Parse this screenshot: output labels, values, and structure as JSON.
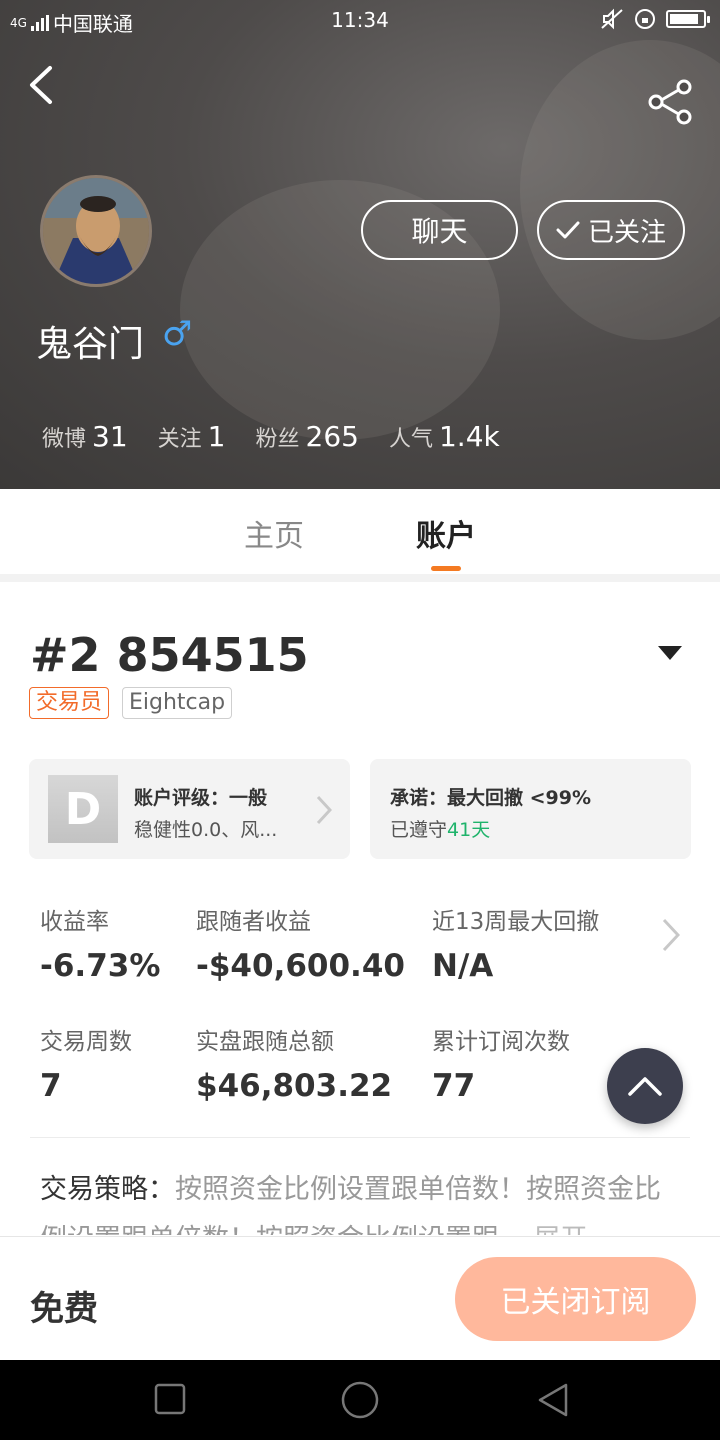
{
  "status_bar": {
    "network": "4G",
    "carrier": "中国联通",
    "time": "11:34",
    "battery_level": 0.9
  },
  "profile": {
    "username": "鬼谷门",
    "gender_symbol": "♂",
    "chat_label": "聊天",
    "follow_label": "已关注",
    "stats": [
      {
        "label": "微博",
        "value": "31"
      },
      {
        "label": "关注",
        "value": "1"
      },
      {
        "label": "粉丝",
        "value": "265"
      },
      {
        "label": "人气",
        "value": "1.4k"
      }
    ]
  },
  "tabs": [
    {
      "label": "主页",
      "active": false
    },
    {
      "label": "账户",
      "active": true
    }
  ],
  "account": {
    "title": "#2 854515",
    "tags": [
      "交易员",
      "Eightcap"
    ],
    "rating_card": {
      "grade": "D",
      "line1": "账户评级：一般",
      "line2": "稳健性0.0、风..."
    },
    "promise_card": {
      "line1": "承诺：最大回撤 <99%",
      "line2_prefix": "已遵守",
      "line2_days": "41天"
    },
    "metrics": [
      {
        "label": "收益率",
        "value": "-6.73%"
      },
      {
        "label": "跟随者收益",
        "value": "-$40,600.40"
      },
      {
        "label": "近13周最大回撤",
        "value": "N/A"
      },
      {
        "label": "交易周数",
        "value": "7"
      },
      {
        "label": "实盘跟随总额",
        "value": "$46,803.22"
      },
      {
        "label": "累计订阅次数",
        "value": "77"
      }
    ],
    "strategy": {
      "label": "交易策略：",
      "text": "按照资金比例设置跟单倍数！按照资金比例设置跟单倍数！按照资金比例设置跟...",
      "expand": "展开"
    }
  },
  "bottom_bar": {
    "price": "免费",
    "subscribe_label": "已关闭订阅"
  },
  "colors": {
    "accent": "#f47a22",
    "tag_orange": "#f26b2a",
    "green": "#1fb36b",
    "subscribe_bg": "#ffb89c",
    "fab_bg": "#3d3f4e"
  },
  "icons": [
    "back-arrow-icon",
    "share-icon",
    "check-icon",
    "chevron-right-icon",
    "chevron-up-icon",
    "nav-recent-icon",
    "nav-home-icon",
    "nav-back-icon"
  ]
}
